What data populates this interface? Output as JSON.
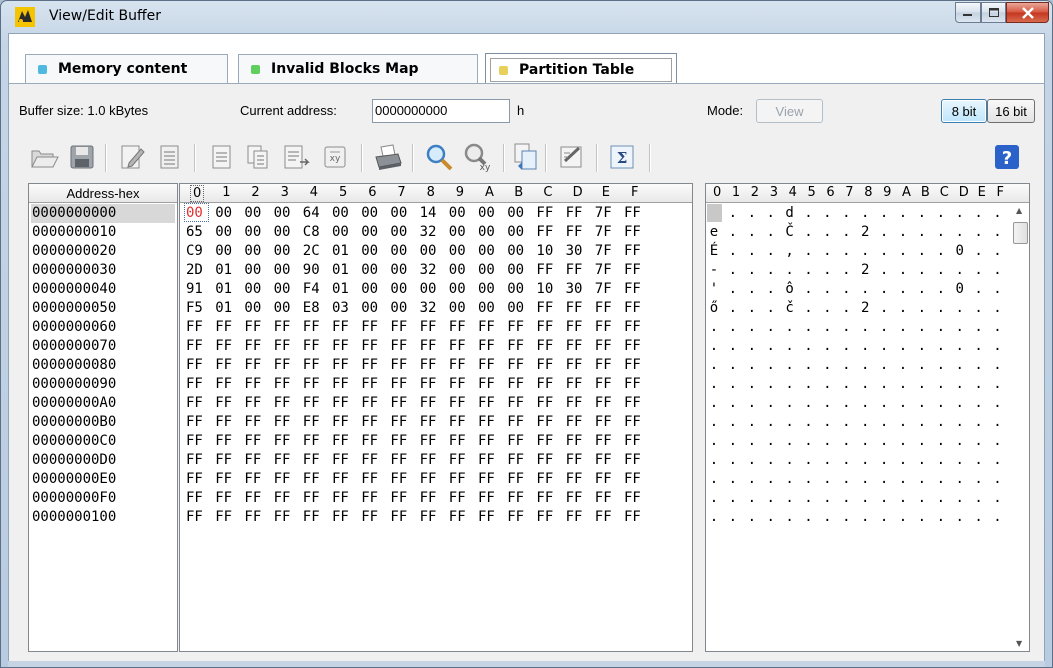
{
  "window": {
    "title": "View/Edit Buffer"
  },
  "tabs": [
    {
      "label": "Memory content",
      "color": "#4fb9e0"
    },
    {
      "label": "Invalid Blocks Map",
      "color": "#5fcf5f"
    },
    {
      "label": "Partition Table",
      "color": "#e8d15a"
    }
  ],
  "info": {
    "buffer_size": "Buffer size: 1.0 kBytes",
    "current_address_label": "Current address:",
    "current_address_value": "0000000000",
    "address_suffix": "h",
    "mode_label": "Mode:",
    "mode_button": "View",
    "bit8": "8 bit",
    "bit16": "16 bit"
  },
  "toolbar_icons": [
    "open-icon",
    "save-icon",
    "edit-icon",
    "list-icon",
    "document-icon",
    "copy-icon",
    "export-icon",
    "xy-icon",
    "print-icon",
    "zoom-icon",
    "zoom-xy-icon",
    "transfer-icon",
    "checklist-icon",
    "sum-icon",
    "help-icon"
  ],
  "grid": {
    "address_header": "Address-hex",
    "hex_header": [
      "0",
      "1",
      "2",
      "3",
      "4",
      "5",
      "6",
      "7",
      "8",
      "9",
      "A",
      "B",
      "C",
      "D",
      "E",
      "F"
    ],
    "ascii_header": [
      "0",
      "1",
      "2",
      "3",
      "4",
      "5",
      "6",
      "7",
      "8",
      "9",
      "A",
      "B",
      "C",
      "D",
      "E",
      "F"
    ],
    "selected_byte": "00",
    "rows": [
      {
        "addr": "0000000000",
        "hex": "00 00 00 00 64 00 00 00 14 00 00 00 FF FF 7F FF",
        "ascii": "....d..........."
      },
      {
        "addr": "0000000010",
        "hex": "65 00 00 00 C8 00 00 00 32 00 00 00 FF FF 7F FF",
        "ascii": "e...Č...2......."
      },
      {
        "addr": "0000000020",
        "hex": "C9 00 00 00 2C 01 00 00 00 00 00 00 10 30 7F FF",
        "ascii": "É...,........0.."
      },
      {
        "addr": "0000000030",
        "hex": "2D 01 00 00 90 01 00 00 32 00 00 00 FF FF 7F FF",
        "ascii": "-.......2......."
      },
      {
        "addr": "0000000040",
        "hex": "91 01 00 00 F4 01 00 00 00 00 00 00 10 30 7F FF",
        "ascii": "'...ô........0.."
      },
      {
        "addr": "0000000050",
        "hex": "F5 01 00 00 E8 03 00 00 32 00 00 00 FF FF FF FF",
        "ascii": "ő...č...2......."
      },
      {
        "addr": "0000000060",
        "hex": "FF FF FF FF FF FF FF FF FF FF FF FF FF FF FF FF",
        "ascii": "................"
      },
      {
        "addr": "0000000070",
        "hex": "FF FF FF FF FF FF FF FF FF FF FF FF FF FF FF FF",
        "ascii": "................"
      },
      {
        "addr": "0000000080",
        "hex": "FF FF FF FF FF FF FF FF FF FF FF FF FF FF FF FF",
        "ascii": "................"
      },
      {
        "addr": "0000000090",
        "hex": "FF FF FF FF FF FF FF FF FF FF FF FF FF FF FF FF",
        "ascii": "................"
      },
      {
        "addr": "00000000A0",
        "hex": "FF FF FF FF FF FF FF FF FF FF FF FF FF FF FF FF",
        "ascii": "................"
      },
      {
        "addr": "00000000B0",
        "hex": "FF FF FF FF FF FF FF FF FF FF FF FF FF FF FF FF",
        "ascii": "................"
      },
      {
        "addr": "00000000C0",
        "hex": "FF FF FF FF FF FF FF FF FF FF FF FF FF FF FF FF",
        "ascii": "................"
      },
      {
        "addr": "00000000D0",
        "hex": "FF FF FF FF FF FF FF FF FF FF FF FF FF FF FF FF",
        "ascii": "................"
      },
      {
        "addr": "00000000E0",
        "hex": "FF FF FF FF FF FF FF FF FF FF FF FF FF FF FF FF",
        "ascii": "................"
      },
      {
        "addr": "00000000F0",
        "hex": "FF FF FF FF FF FF FF FF FF FF FF FF FF FF FF FF",
        "ascii": "................"
      },
      {
        "addr": "0000000100",
        "hex": "FF FF FF FF FF FF FF FF FF FF FF FF FF FF FF FF",
        "ascii": "................"
      }
    ]
  },
  "colors": {
    "selected_byte": "#e03030",
    "help": "#2a62c9"
  }
}
